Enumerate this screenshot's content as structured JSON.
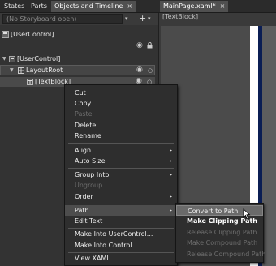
{
  "left_panel": {
    "tabs": [
      {
        "label": "States"
      },
      {
        "label": "Parts"
      },
      {
        "label": "Objects and Timeline",
        "close": "×"
      }
    ],
    "storyboard": {
      "placeholder": "(No Storyboard open)",
      "caret": "▾",
      "add": "+",
      "add_caret": "▾"
    },
    "tree": {
      "root_control": "[UserControl]",
      "user_control": "[UserControl]",
      "layout_root": "LayoutRoot",
      "text_block": "[TextBlock]"
    }
  },
  "document": {
    "tab": {
      "label": "MainPage.xaml*",
      "close": "×"
    },
    "breadcrumb": "[TextBlock]"
  },
  "context_menu": {
    "items": [
      {
        "label": "Cut",
        "enabled": true
      },
      {
        "label": "Copy",
        "enabled": true
      },
      {
        "label": "Paste",
        "enabled": false
      },
      {
        "label": "Delete",
        "enabled": true
      },
      {
        "label": "Rename",
        "enabled": true
      },
      {
        "label": "Align",
        "enabled": true,
        "submenu": true
      },
      {
        "label": "Auto Size",
        "enabled": true,
        "submenu": true
      },
      {
        "label": "Group Into",
        "enabled": true,
        "submenu": true
      },
      {
        "label": "Ungroup",
        "enabled": false
      },
      {
        "label": "Order",
        "enabled": true,
        "submenu": true
      },
      {
        "label": "Path",
        "enabled": true,
        "submenu": true,
        "highlighted": true
      },
      {
        "label": "Edit Text",
        "enabled": true
      },
      {
        "label": "Make Into UserControl...",
        "enabled": true
      },
      {
        "label": "Make Into Control...",
        "enabled": true
      },
      {
        "label": "View XAML",
        "enabled": true
      }
    ],
    "submenu_arrow": "▸"
  },
  "path_submenu": {
    "items": [
      {
        "label": "Convert to Path",
        "enabled": true,
        "highlighted": true
      },
      {
        "label": "Make Clipping Path",
        "enabled": true,
        "bold": true
      },
      {
        "label": "Release Clipping Path",
        "enabled": false
      },
      {
        "label": "Make Compound Path",
        "enabled": false
      },
      {
        "label": "Release Compound Path",
        "enabled": false
      }
    ]
  },
  "colors": {
    "panel_bg": "#333333",
    "menu_bg": "#2e2e2e",
    "artboard_border": "#0b1e54",
    "disabled_text": "#6e6e6e"
  }
}
